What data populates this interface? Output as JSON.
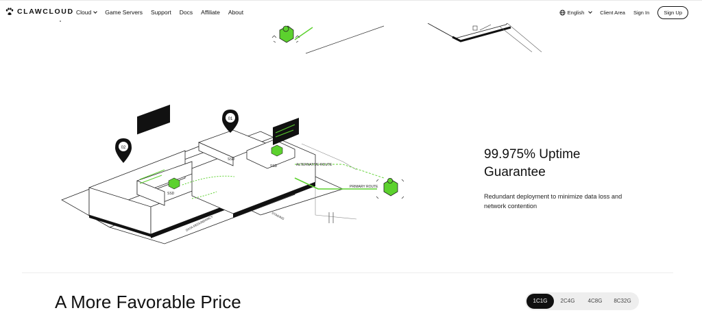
{
  "nav": {
    "brand": "CLAWCLOUD",
    "menu": [
      {
        "label": "Cloud"
      },
      {
        "label": "Game Servers"
      },
      {
        "label": "Support"
      },
      {
        "label": "Docs"
      },
      {
        "label": "Affiliate"
      },
      {
        "label": "About"
      }
    ],
    "language": "English",
    "client_area": "Client Area",
    "sign_in": "Sign In",
    "sign_up": "Sign Up"
  },
  "illustration": {
    "marker_1": "01",
    "marker_2": "02",
    "alternative_route": "ALTERNATIVE ROUTE",
    "primary_route": "PRIMARY ROUTE",
    "ssd_1": "SSD",
    "ssd_2": "SSD",
    "ssd_3": "SSD",
    "ground_label_1": "DATA REDUNDANCY",
    "ground_label_2": "STAGING",
    "accent_color": "#5cd12e"
  },
  "feature": {
    "title": "99.975% Uptime Guarantee",
    "description": "Redundant deployment to minimize data loss and network contention"
  },
  "pricing": {
    "title": "A More Favorable Price",
    "tabs": [
      "1C1G",
      "2C4G",
      "4C8G",
      "8C32G"
    ],
    "active_tab": "1C1G"
  }
}
